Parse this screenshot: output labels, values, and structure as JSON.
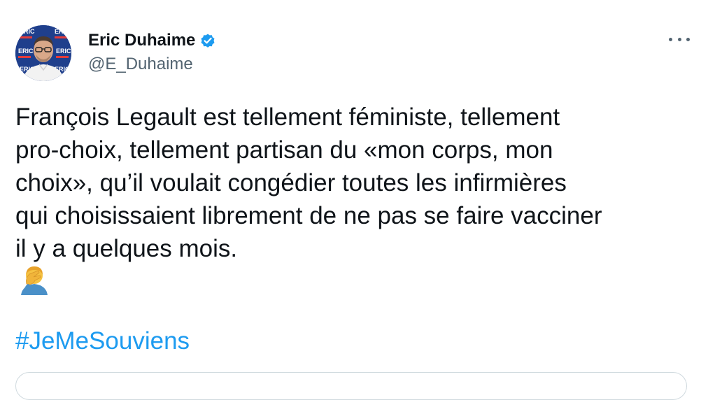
{
  "author": {
    "display_name": "Eric Duhaime",
    "handle": "@E_Duhaime",
    "verified": true,
    "avatar_backdrop_text": "ERIC"
  },
  "tweet": {
    "lines": [
      "François Legault est tellement féministe, tellement",
      "pro-choix, tellement partisan du «mon corps, mon",
      "choix», qu’il voulait congédier toutes les infirmières",
      "qui choisissaient librement de ne pas se faire vacciner",
      "il y a quelques mois."
    ],
    "emoji": "face-palm",
    "hashtag": "#JeMeSouviens"
  },
  "icons": {
    "verified": "verified-badge-icon",
    "more": "more-options-icon"
  },
  "colors": {
    "link": "#1d9bf0",
    "secondary_text": "#536471",
    "primary_text": "#0f1419",
    "verified": "#1d9bf0"
  }
}
